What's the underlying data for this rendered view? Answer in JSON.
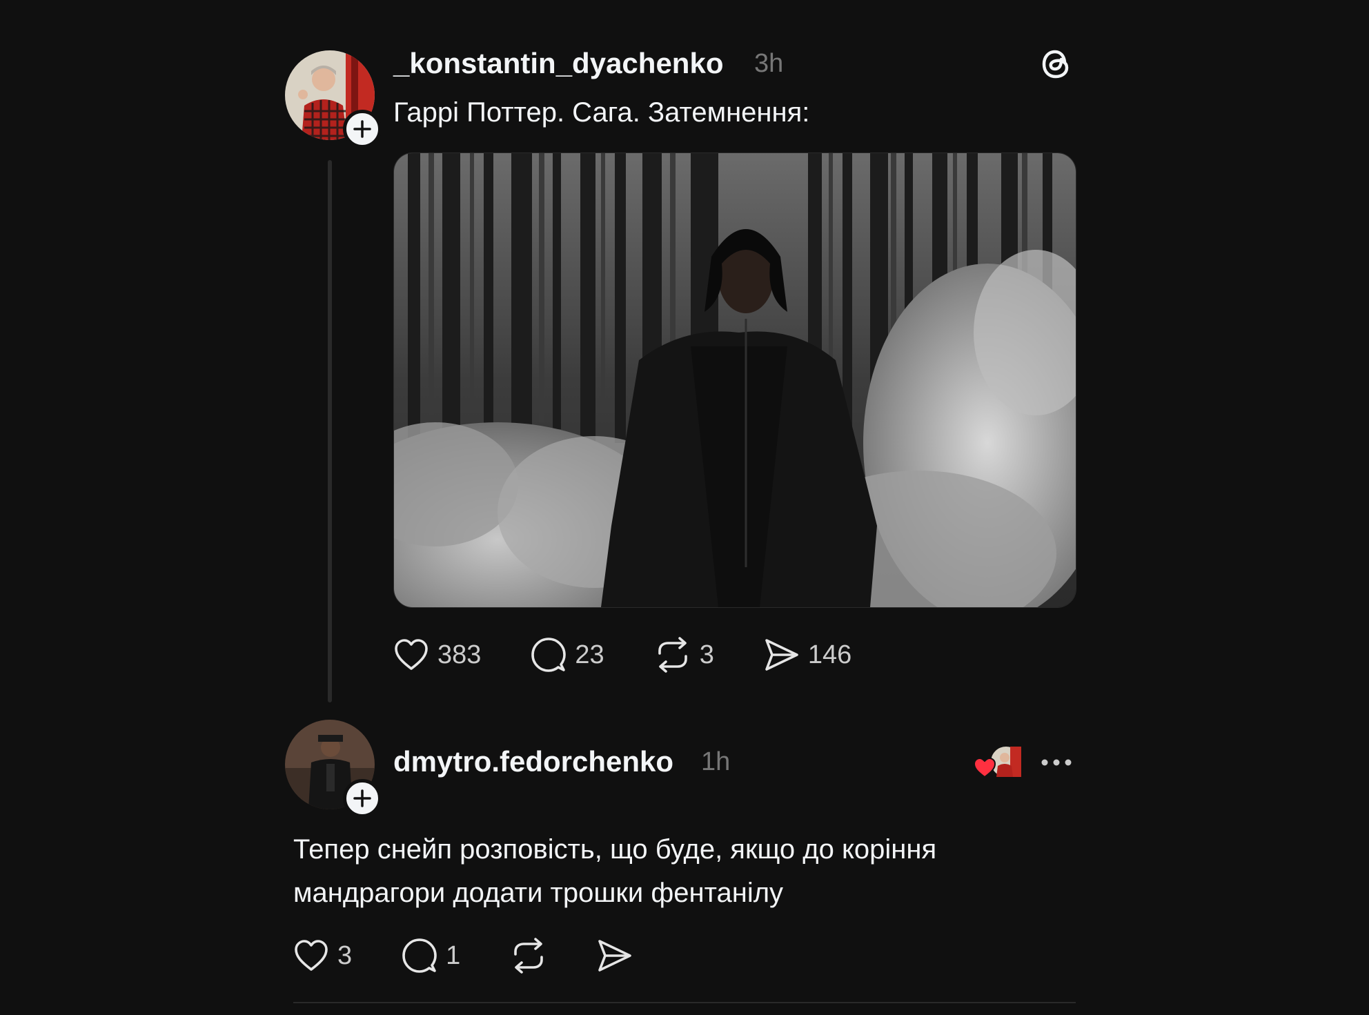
{
  "post": {
    "username": "_konstantin_dyachenko",
    "time": "3h",
    "text": "Гаррі Поттер. Сага. Затемнення:",
    "avatar_icon": "user-avatar",
    "image_icon": "forest-photo",
    "stats": {
      "likes": "383",
      "replies": "23",
      "reposts": "3",
      "shares": "146"
    }
  },
  "reply": {
    "username": "dmytro.fedorchenko",
    "time": "1h",
    "text": "Тепер снейп розповість, що буде, якщо до коріння мандрагори додати трошки фентанілу",
    "avatar_icon": "user-avatar",
    "stats": {
      "likes": "3",
      "replies": "1"
    }
  },
  "icons": {
    "like": "heart-icon",
    "reply": "comment-icon",
    "repost": "repost-icon",
    "share": "share-icon",
    "threads": "threads-logo-icon",
    "more": "more-icon",
    "follow": "plus-icon"
  },
  "colors": {
    "background": "#101010",
    "text": "#f3f5f7",
    "muted": "#777777",
    "liked_heart": "#ff3040"
  }
}
